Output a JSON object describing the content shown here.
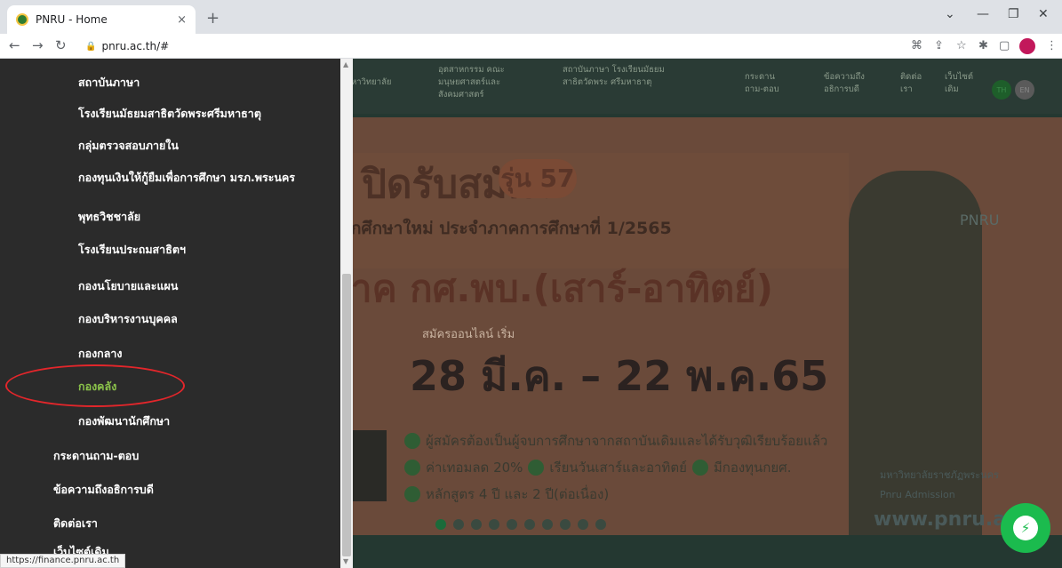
{
  "browser": {
    "tab_title": "PNRU - Home",
    "tab_close": "×",
    "new_tab": "+",
    "url": "pnru.ac.th/#",
    "minimize": "—",
    "restore": "❐",
    "close": "✕",
    "chevron": "⌄",
    "status_url": "https://finance.pnru.ac.th"
  },
  "site_nav": [
    {
      "label": "หาวิทยาลัย"
    },
    {
      "label": "อุตสาหกรรม คณะมนุษยศาสตร์และ สังคมศาสตร์"
    },
    {
      "label": "สถาบันภาษา โรงเรียนมัธยมสาธิตวัดพระ ศรีมหาธาตุ"
    },
    {
      "label": "กระดาน ถาม-ตอบ"
    },
    {
      "label": "ข้อความถึง อธิการบดี"
    },
    {
      "label": "ติดต่อ เรา"
    },
    {
      "label": "เว็บไซต์ เดิม"
    }
  ],
  "badges": {
    "th": "TH",
    "en": "EN"
  },
  "banner": {
    "headline": "ปิดรับสมัคร",
    "round_badge": "รุ่น 57",
    "subtitle": "ักศึกษาใหม่ ประจำภาคการศึกษาที่ 1/2565",
    "program": "าค กศ.พบ.(เสาร์-อาทิตย์)",
    "apply_label": "สมัครออนไลน์ เริ่ม",
    "dates": "28 มี.ค. – 22 พ.ค.65",
    "bullets": [
      "ผู้สมัครต้องเป็นผู้จบการศึกษาจากสถาบันเดิมและได้รับวุฒิเรียบร้อยแล้ว",
      "ค่าเทอมลด 20%",
      "เรียนวันเสาร์และอาทิตย์",
      "มีกองทุนกยศ.",
      "หลักสูตร 4 ปี และ 2 ปี(ต่อเนื่อง)"
    ],
    "brand": "PNRU",
    "social1": "มหาวิทยาลัยราชภัฏพระนคร",
    "social2": "Pnru Admission",
    "website": "www.pnru.ac"
  },
  "menu": {
    "items": [
      {
        "label": "สถาบันภาษา",
        "level": "sub"
      },
      {
        "label": "โรงเรียนมัธยมสาธิตวัดพระศรีมหาธาตุ",
        "level": "sub"
      },
      {
        "label": "กลุ่มตรวจสอบภายใน",
        "level": "sub"
      },
      {
        "label": "กองทุนเงินให้กู้ยืมเพื่อการศึกษา มรภ.พระนคร",
        "level": "sub"
      },
      {
        "label": "พุทธวิชชาลัย",
        "level": "sub"
      },
      {
        "label": "โรงเรียนประถมสาธิตฯ",
        "level": "sub"
      },
      {
        "label": "กองนโยบายและแผน",
        "level": "sub"
      },
      {
        "label": "กองบริหารงานบุคคล",
        "level": "sub"
      },
      {
        "label": "กองกลาง",
        "level": "sub"
      },
      {
        "label": "กองคลัง",
        "level": "sub",
        "active": true
      },
      {
        "label": "กองพัฒนานักศึกษา",
        "level": "sub"
      },
      {
        "label": "กระดานถาม-ตอบ",
        "level": "top"
      },
      {
        "label": "ข้อความถึงอธิการบดี",
        "level": "top"
      },
      {
        "label": "ติดต่อเรา",
        "level": "top"
      },
      {
        "label": "เว็บไซต์เดิม",
        "level": "top"
      }
    ]
  },
  "rail": {
    "lang": "TH"
  }
}
